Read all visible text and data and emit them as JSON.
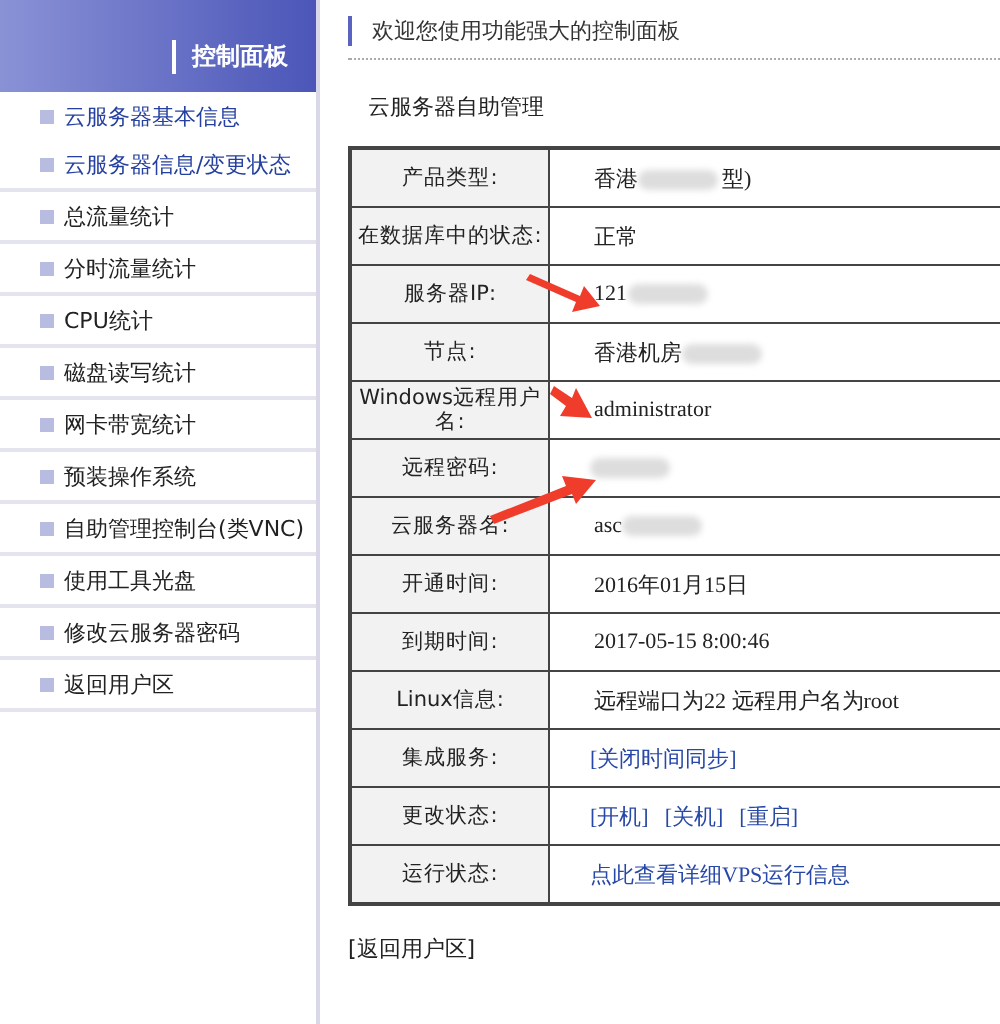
{
  "sidebar": {
    "title": "控制面板",
    "groups": [
      {
        "items": [
          {
            "label": "云服务器基本信息",
            "selected": true
          },
          {
            "label": "云服务器信息/变更状态",
            "selected": true
          }
        ]
      },
      {
        "items": [
          {
            "label": "总流量统计",
            "selected": false
          }
        ]
      },
      {
        "items": [
          {
            "label": "分时流量统计",
            "selected": false
          }
        ]
      },
      {
        "items": [
          {
            "label": "CPU统计",
            "selected": false
          }
        ]
      },
      {
        "items": [
          {
            "label": "磁盘读写统计",
            "selected": false
          }
        ]
      },
      {
        "items": [
          {
            "label": "网卡带宽统计",
            "selected": false
          }
        ]
      },
      {
        "items": [
          {
            "label": "预装操作系统",
            "selected": false
          }
        ]
      },
      {
        "items": [
          {
            "label": "自助管理控制台(类VNC)",
            "selected": false
          }
        ]
      },
      {
        "items": [
          {
            "label": "使用工具光盘",
            "selected": false
          }
        ]
      },
      {
        "items": [
          {
            "label": "修改云服务器密码",
            "selected": false
          }
        ]
      },
      {
        "items": [
          {
            "label": "返回用户区",
            "selected": false
          }
        ]
      }
    ]
  },
  "welcome": "欢迎您使用功能强大的控制面板",
  "section_title": "云服务器自助管理",
  "table": {
    "rows": [
      {
        "label": "产品类型:",
        "value": [
          {
            "kind": "text",
            "text": "香港"
          },
          {
            "kind": "blur"
          },
          {
            "kind": "text",
            "text": "型)"
          }
        ]
      },
      {
        "label": "在数据库中的状态:",
        "value": [
          {
            "kind": "text",
            "text": "正常"
          }
        ]
      },
      {
        "label": "服务器IP:",
        "value": [
          {
            "kind": "text",
            "text": "121"
          },
          {
            "kind": "blur"
          }
        ]
      },
      {
        "label": "节点:",
        "value": [
          {
            "kind": "text",
            "text": "香港机房"
          },
          {
            "kind": "blur"
          }
        ]
      },
      {
        "label": "Windows远程用户名:",
        "value": [
          {
            "kind": "text",
            "text": "administrator"
          }
        ]
      },
      {
        "label": "远程密码:",
        "value": [
          {
            "kind": "blur"
          }
        ]
      },
      {
        "label": "云服务器名:",
        "value": [
          {
            "kind": "text",
            "text": "asc"
          },
          {
            "kind": "blur"
          }
        ]
      },
      {
        "label": "开通时间:",
        "value": [
          {
            "kind": "text",
            "text": "2016年01月15日"
          }
        ]
      },
      {
        "label": "到期时间:",
        "value": [
          {
            "kind": "text",
            "text": "2017-05-15 8:00:46"
          }
        ]
      },
      {
        "label": "Linux信息:",
        "value": [
          {
            "kind": "text",
            "text": "远程端口为22 远程用户名为root"
          }
        ]
      },
      {
        "label": "集成服务:",
        "value": [
          {
            "kind": "link",
            "text": "[关闭时间同步]"
          }
        ]
      },
      {
        "label": "更改状态:",
        "value": [
          {
            "kind": "link",
            "text": "[开机]"
          },
          {
            "kind": "link",
            "text": "[关机]"
          },
          {
            "kind": "link",
            "text": "[重启]"
          }
        ]
      },
      {
        "label": "运行状态:",
        "value": [
          {
            "kind": "link",
            "text": "点此查看详细VPS运行信息"
          }
        ]
      }
    ]
  },
  "back_link": "[返回用户区]"
}
